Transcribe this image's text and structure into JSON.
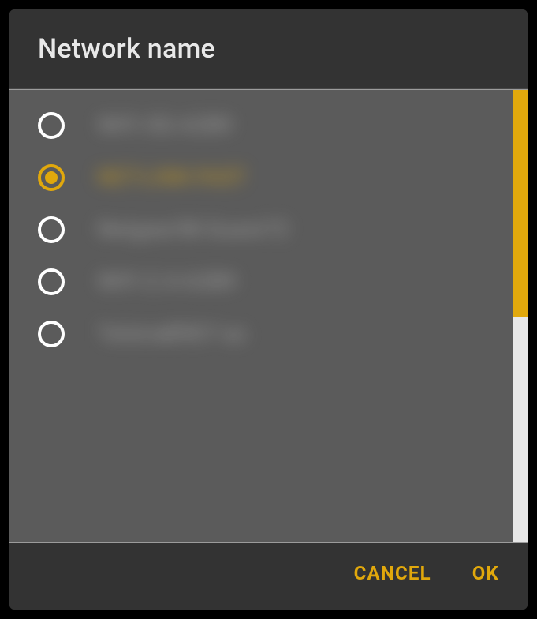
{
  "dialog": {
    "title": "Network name"
  },
  "networks": [
    {
      "label": "WiFi-5G-A2B9",
      "selected": false
    },
    {
      "label": "NET-LINK-FAST",
      "selected": true
    },
    {
      "label": "Netgear58-Guest72",
      "selected": false
    },
    {
      "label": "WiFi-2.4-A2B9",
      "selected": false
    },
    {
      "label": "TelstraB9D7-ac",
      "selected": false
    }
  ],
  "actions": {
    "cancel": "CANCEL",
    "ok": "OK"
  },
  "colors": {
    "accent": "#e1a80c",
    "bg_dialog": "#333333",
    "bg_list": "#5b5b5b"
  }
}
